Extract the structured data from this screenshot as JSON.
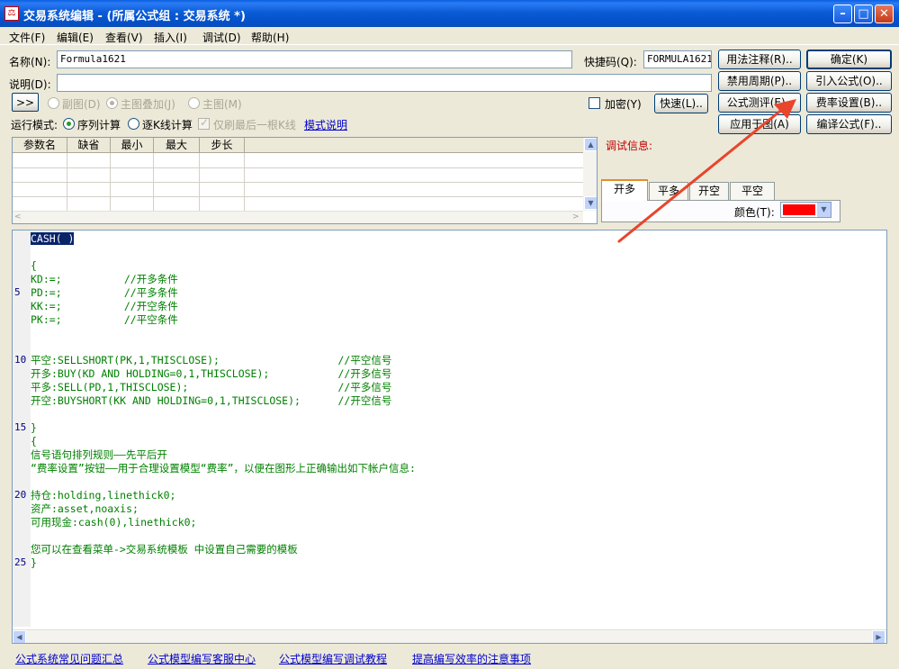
{
  "window": {
    "title": "交易系统编辑 - (所属公式组 : 交易系统 *)",
    "icon_glyph": "⚖"
  },
  "menu": [
    "文件(F)",
    "编辑(E)",
    "查看(V)",
    "插入(I)",
    "调试(D)",
    "帮助(H)"
  ],
  "form": {
    "name_label": "名称(N):",
    "name_value": "Formula1621",
    "shortcut_label": "快捷码(Q):",
    "shortcut_value": "FORMULA1621",
    "desc_label": "说明(D):",
    "desc_value": "",
    "expand_button": ">>",
    "chart_options": [
      "副图(D)",
      "主图叠加(J)",
      "主图(M)"
    ],
    "encrypt_label": "加密(Y)",
    "run_mode_label": "运行模式:",
    "run_modes": [
      "序列计算",
      "逐K线计算"
    ],
    "last_bar_label": "仅刷最后一根K线",
    "mode_help_link": "模式说明"
  },
  "buttons": {
    "usage_note": "用法注释(R)..",
    "ok": "确定(K)",
    "disable_period": "禁用周期(P)..",
    "import_formula": "引入公式(O)..",
    "quick": "快速(L)..",
    "formula_test": "公式测评(E)..",
    "fee_setting": "费率设置(B)..",
    "apply_to_chart": "应用于图(A)",
    "compile": "编译公式(F).."
  },
  "params": {
    "headers": [
      "参数名",
      "缺省",
      "最小",
      "最大",
      "步长"
    ]
  },
  "debug": {
    "label": "调试信息:",
    "tabs": [
      "开多",
      "平多",
      "开空",
      "平空"
    ],
    "color_label": "颜色(T):",
    "color_value": "#FF0000"
  },
  "editor": {
    "line_numbers": [
      "5",
      "10",
      "15",
      "20",
      "25"
    ],
    "lines": [
      "CASH( )",
      "",
      "{",
      "KD:=;          //开多条件",
      "PD:=;          //平多条件",
      "KK:=;          //开空条件",
      "PK:=;          //平空条件",
      "",
      "",
      "平空:SELLSHORT(PK,1,THISCLOSE);                   //平空信号",
      "开多:BUY(KD AND HOLDING=0,1,THISCLOSE);           //开多信号",
      "平多:SELL(PD,1,THISCLOSE);                        //平多信号",
      "开空:BUYSHORT(KK AND HOLDING=0,1,THISCLOSE);      //开空信号",
      "",
      "}",
      "{",
      "信号语句排列规则——先平后开",
      "“费率设置”按钮——用于合理设置模型“费率”，以便在图形上正确输出如下帐户信息:",
      "",
      "持仓:holding,linethick0;",
      "资产:asset,noaxis;",
      "可用现金:cash(0),linethick0;",
      "",
      "您可以在查看菜单->交易系统模板 中设置自己需要的模板",
      "}"
    ]
  },
  "footer_links": [
    "公式系统常见问题汇总",
    "公式模型编写客服中心",
    "公式模型编写调试教程",
    "提高编写效率的注意事项"
  ],
  "colors": {
    "titlebar": "#0A5FE0",
    "code_text": "#008000",
    "annotation_arrow": "#E8452C"
  }
}
